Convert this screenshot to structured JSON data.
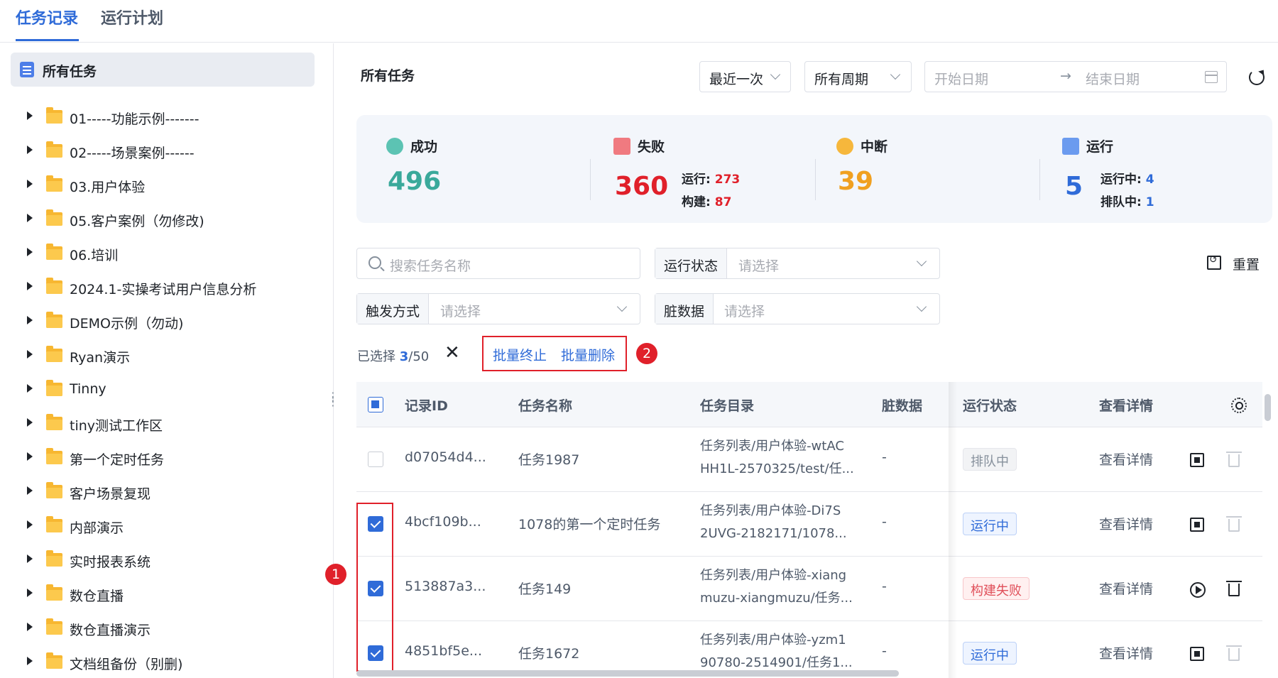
{
  "tabs": [
    "任务记录",
    "运行计划"
  ],
  "sidebar": {
    "root_label": "所有任务",
    "items": [
      "01-----功能示例-------",
      "02-----场景案例------",
      "03.用户体验",
      "05.客户案例（勿修改)",
      "06.培训",
      "2024.1-实操考试用户信息分析",
      "DEMO示例（勿动)",
      "Ryan演示",
      "Tinny",
      "tiny测试工作区",
      "第一个定时任务",
      "客户场景复现",
      "内部演示",
      "实时报表系统",
      "数仓直播",
      "数仓直播演示",
      "文档组备份（别删)"
    ]
  },
  "main": {
    "title": "所有任务",
    "filter_recent": "最近一次",
    "filter_period": "所有周期",
    "start_date_placeholder": "开始日期",
    "end_date_placeholder": "结束日期",
    "arrow": "→"
  },
  "stats": {
    "success": {
      "label": "成功",
      "value": "496",
      "color": "#3aa99b"
    },
    "fail": {
      "label": "失败",
      "value": "360",
      "color": "#e0202a",
      "run_label": "运行:",
      "run_value": "273",
      "build_label": "构建:",
      "build_value": "87"
    },
    "interrupt": {
      "label": "中断",
      "value": "39",
      "color": "#f0a020"
    },
    "running": {
      "label": "运行",
      "value": "5",
      "color": "#2f6bd8",
      "running_label": "运行中:",
      "running_value": "4",
      "queued_label": "排队中:",
      "queued_value": "1"
    }
  },
  "filters": {
    "search_placeholder": "搜索任务名称",
    "run_status_label": "运行状态",
    "trigger_label": "触发方式",
    "dirty_label": "脏数据",
    "select_placeholder": "请选择",
    "reset_label": "重置"
  },
  "selection": {
    "prefix": "已选择",
    "count": "3",
    "total": "/50",
    "batch_stop": "批量终止",
    "batch_delete": "批量删除",
    "badge_1": "1",
    "badge_2": "2"
  },
  "table": {
    "headers": [
      "记录ID",
      "任务名称",
      "任务目录",
      "脏数据",
      "运行状态",
      "查看详情"
    ],
    "rows": [
      {
        "id": "d07054d4...",
        "name": "任务1987",
        "dir1": "任务列表/用户体验-wtAC",
        "dir2": "HH1L-2570325/test/任...",
        "dirty": "-",
        "status": "排队中",
        "detail": "查看详情",
        "checked": false
      },
      {
        "id": "4bcf109b...",
        "name": "1078的第一个定时任务",
        "dir1": "任务列表/用户体验-Di7S",
        "dir2": "2UVG-2182171/1078...",
        "dirty": "-",
        "status": "运行中",
        "detail": "查看详情",
        "checked": true
      },
      {
        "id": "513887a3...",
        "name": "任务149",
        "dir1": "任务列表/用户体验-xiang",
        "dir2": "muzu-xiangmuzu/任务...",
        "dirty": "-",
        "status": "构建失败",
        "detail": "查看详情",
        "checked": true
      },
      {
        "id": "4851bf5e...",
        "name": "任务1672",
        "dir1": "任务列表/用户体验-yzm1",
        "dir2": "90780-2514901/任务1...",
        "dirty": "-",
        "status": "运行中",
        "detail": "查看详情",
        "checked": true
      }
    ]
  }
}
